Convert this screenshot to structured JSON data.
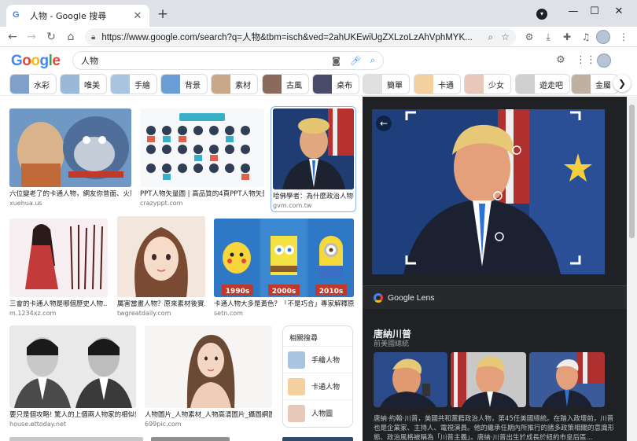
{
  "browser": {
    "tab_title": "人物 - Google 搜尋",
    "tab_favicon": "G",
    "close_tab": "✕",
    "new_tab": "+",
    "url": "https://www.google.com/search?q=人物&tbm=isch&ved=2ahUKEwiUgZXLzoLzAhVphMYK...",
    "window_controls": {
      "minimize": "—",
      "maximize": "☐",
      "close": "✕"
    }
  },
  "google": {
    "logo_letters": [
      "G",
      "o",
      "o",
      "g",
      "l",
      "e"
    ],
    "search_value": "人物"
  },
  "chips": [
    {
      "label": "水彩",
      "color": "#7fa0c8"
    },
    {
      "label": "唯美",
      "color": "#9ab8d8"
    },
    {
      "label": "手繪",
      "color": "#a8c4e0"
    },
    {
      "label": "背景",
      "color": "#6a9ed4"
    },
    {
      "label": "素材",
      "color": "#c8a888"
    },
    {
      "label": "古風",
      "color": "#8a6a5a"
    },
    {
      "label": "桌布",
      "color": "#4a4a6a"
    },
    {
      "label": "簡單",
      "color": "#e0e0e0"
    },
    {
      "label": "卡通",
      "color": "#f4d0a0"
    },
    {
      "label": "少女",
      "color": "#e8c8b8"
    },
    {
      "label": "遊走吧",
      "color": "#d0d0d0"
    },
    {
      "label": "金屬",
      "color": "#c0b0a0"
    }
  ],
  "results": [
    {
      "caption": "六位變老了的卡通人物，網友你昔面、火影裡...",
      "source": "xuehua.us"
    },
    {
      "caption": "PPT人物矢量圖 | 高品質的4頁PPT人物矢量素材下...",
      "source": "crazyppt.com"
    },
    {
      "caption": "哈佛學者：為什麼政治人物不...",
      "source": "gvm.com.tw"
    },
    {
      "caption": "三會的卡通人物是哪個歷史人物...",
      "source": "m.1234xz.com"
    },
    {
      "caption": "厲害當畫人物？原來素材後實...",
      "source": "twgreatdaily.com"
    },
    {
      "caption": "卡通人物大多是黃色？「不是巧合」專家解釋原因...",
      "source": "setn.com"
    },
    {
      "caption": "要只是個攻略! 驚人的上個兩人物家的相似性...",
      "source": "house.ettoday.net"
    },
    {
      "caption": "人物圖片_人物素材_人物高清圖片_攝圖網圖片下載",
      "source": "699pic.com"
    }
  ],
  "chart_labels": {
    "y1990": "1990s",
    "y2000": "2000s",
    "y2010": "2010s"
  },
  "related": {
    "title": "相關搜尋",
    "items": [
      "手繪人物",
      "卡通人物",
      "人物圖"
    ]
  },
  "lens": {
    "back": "←",
    "brand": "Google Lens",
    "title": "唐納川普",
    "subtitle": "前美國總統",
    "description": "唐納·約翰·川普，美國共和黨籍政治人物，第45任美國總統。在踏入政壇前，川普也是企業家、主持人、電視演員。他的繼承任期內所推行的諸多政策相關的意識形態、政治風格被稱為「川普主義」。唐納·川普出生於成長於紐約市皇后區..."
  }
}
